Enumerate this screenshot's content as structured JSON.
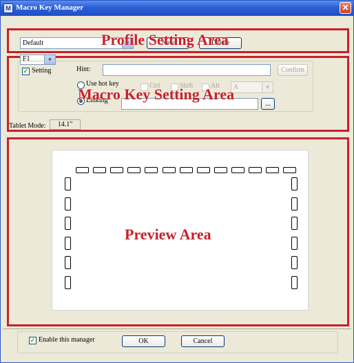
{
  "window": {
    "title": "Macro Key Manager",
    "icon": "app-icon",
    "close_glyph": "✕"
  },
  "profile": {
    "selected": "Default",
    "new_label": "New",
    "delete_label": "Delete",
    "area_label": "Profile Setting Area"
  },
  "macro": {
    "key_selected": "F1",
    "setting_label": "Setting",
    "hint_label": "Hint:",
    "confirm_label": "Confirm",
    "use_hot_key_label": "Use hot key",
    "ctrl_label": "Ctrl",
    "shift_label": "Shift",
    "alt_label": "Alt",
    "key_letter": "A",
    "linking_label": "Linking",
    "browse_label": "...",
    "area_label": "Macro Key Setting Area",
    "selected_mode": "linking"
  },
  "tablet": {
    "mode_label": "Tablet Mode:",
    "size": "14.1\""
  },
  "preview": {
    "area_label": "Preview Area",
    "top_keys": 13,
    "left_keys": 6,
    "right_keys": 6
  },
  "footer": {
    "enable_label": "Enable this manager",
    "ok_label": "OK",
    "cancel_label": "Cancel"
  },
  "colors": {
    "accent_red": "#c8202a",
    "title_blue": "#2a5fd6",
    "window_bg": "#ece9d8"
  }
}
